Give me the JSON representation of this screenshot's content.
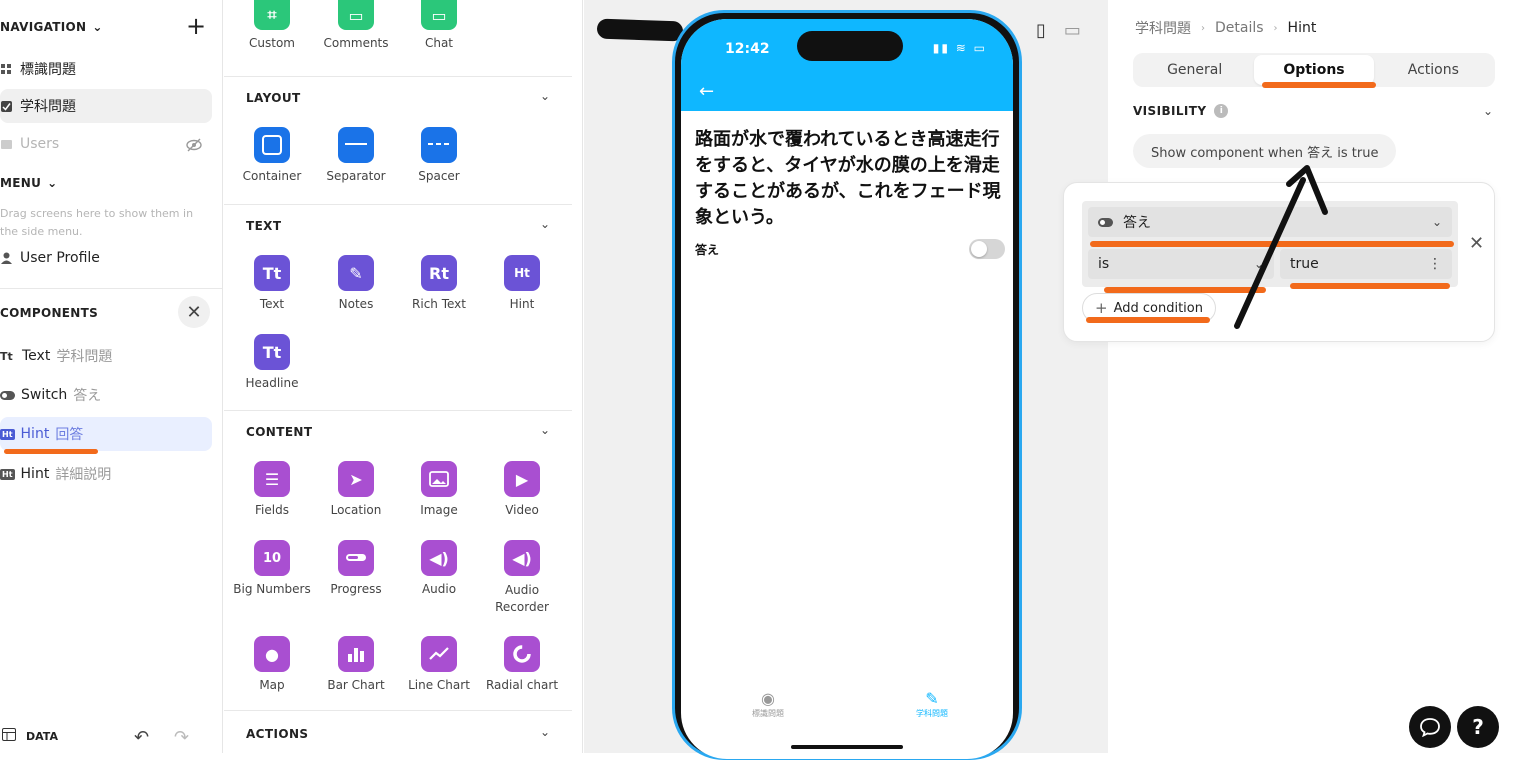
{
  "left": {
    "navigation_header": "NAVIGATION",
    "nav_items": [
      {
        "label": "標識問題"
      },
      {
        "label": "学科問題"
      },
      {
        "label": "Users"
      }
    ],
    "menu_header": "MENU",
    "menu_hint": "Drag screens here to show them in the side menu.",
    "menu_items": [
      {
        "label": "User Profile"
      }
    ],
    "components_header": "COMPONENTS",
    "components": [
      {
        "type": "Text",
        "name": "学科問題"
      },
      {
        "type": "Switch",
        "name": "答え"
      },
      {
        "type": "Hint",
        "name": "回答"
      },
      {
        "type": "Hint",
        "name": "詳細説明"
      }
    ],
    "data_label": "DATA"
  },
  "palette": {
    "top_tiles": [
      {
        "label": "Custom"
      },
      {
        "label": "Comments"
      },
      {
        "label": "Chat"
      }
    ],
    "layout": {
      "title": "LAYOUT",
      "tiles": [
        {
          "label": "Container"
        },
        {
          "label": "Separator"
        },
        {
          "label": "Spacer"
        }
      ]
    },
    "text": {
      "title": "TEXT",
      "tiles": [
        {
          "label": "Text",
          "glyph": "Tt"
        },
        {
          "label": "Notes",
          "glyph": "✎"
        },
        {
          "label": "Rich Text",
          "glyph": "Rt"
        },
        {
          "label": "Hint",
          "glyph": "Ht"
        },
        {
          "label": "Headline",
          "glyph": "Tt"
        }
      ]
    },
    "content": {
      "title": "CONTENT",
      "tiles": [
        {
          "label": "Fields"
        },
        {
          "label": "Location"
        },
        {
          "label": "Image"
        },
        {
          "label": "Video"
        },
        {
          "label": "Big Numbers",
          "glyph": "10"
        },
        {
          "label": "Progress"
        },
        {
          "label": "Audio"
        },
        {
          "label": "Audio Recorder"
        },
        {
          "label": "Map"
        },
        {
          "label": "Bar Chart"
        },
        {
          "label": "Line Chart"
        },
        {
          "label": "Radial chart"
        }
      ]
    },
    "actions": {
      "title": "ACTIONS"
    }
  },
  "phone": {
    "time": "12:42",
    "question": "路面が水で覆われているとき高速走行をすると、タイヤが水の膜の上を滑走することがあるが、これをフェード現象という。",
    "switch_label": "答え",
    "tabs": [
      {
        "label": "標識問題"
      },
      {
        "label": "学科問題"
      }
    ]
  },
  "right": {
    "breadcrumb": [
      "学科問題",
      "Details",
      "Hint"
    ],
    "tabs": [
      {
        "label": "General"
      },
      {
        "label": "Options"
      },
      {
        "label": "Actions"
      }
    ],
    "visibility_header": "VISIBILITY",
    "visibility_summary": "Show component when 答え is true",
    "condition": {
      "field": "答え",
      "operator": "is",
      "value": "true"
    },
    "add_condition": "Add condition"
  },
  "colors": {
    "accent_blue": "#0fb7ff",
    "annotation_orange": "#f26a1b",
    "hint_selected": "#4a5bd4"
  },
  "icons": [
    "chevron-down-icon",
    "plus-icon",
    "grid-icon",
    "checklist-icon",
    "user-icon",
    "eye-off-icon",
    "close-icon",
    "undo-icon",
    "redo-icon",
    "table-icon",
    "info-icon",
    "more-icon",
    "chat-icon",
    "help-icon"
  ]
}
